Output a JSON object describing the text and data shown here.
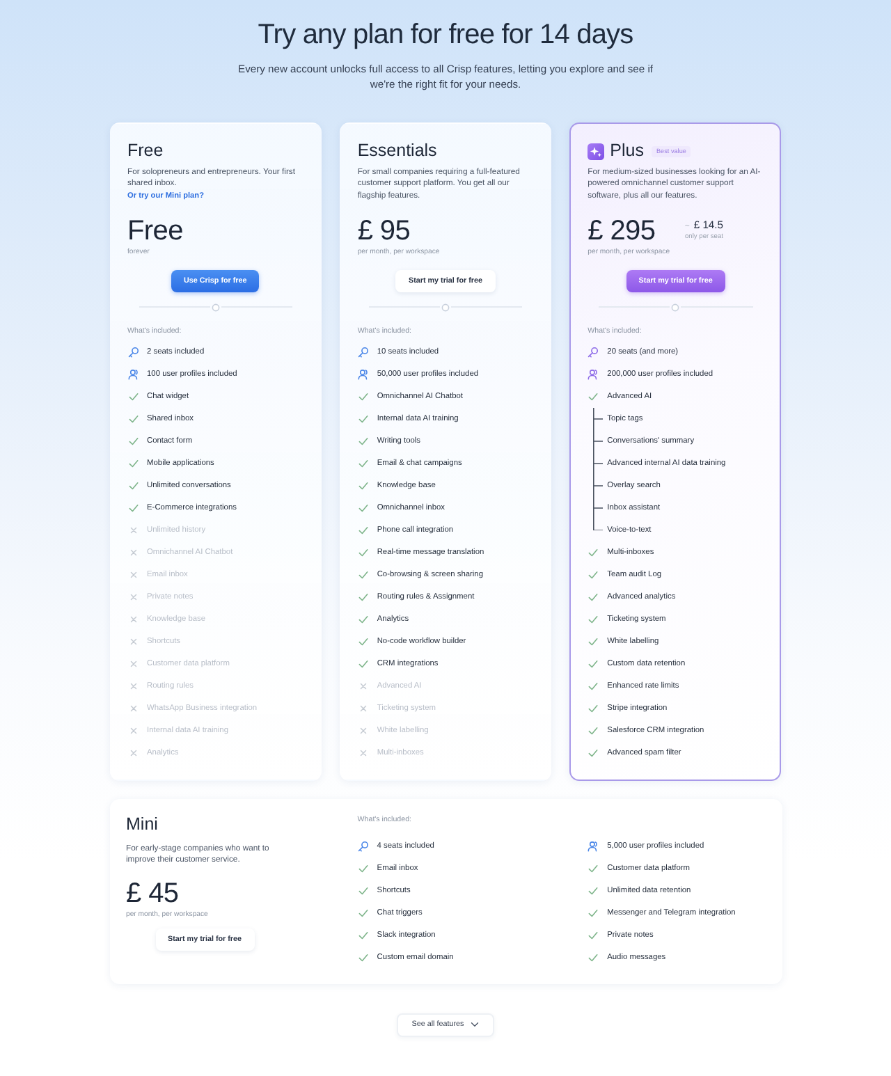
{
  "header": {
    "title": "Try any plan for free for 14 days",
    "subtitle": "Every new account unlocks full access to all Crisp features, letting you explore and see if we're the right fit for your needs."
  },
  "plans": [
    {
      "name": "Free",
      "featured": false,
      "description": "For solopreneurs and entrepreneurs. Your first shared inbox.",
      "link": "Or try our Mini plan?",
      "price": "Free",
      "price_note": "forever",
      "button": {
        "label": "Use Crisp for free",
        "kind": "primary"
      },
      "included_label": "What's included:",
      "features": [
        {
          "label": "2 seats included",
          "kind": "seats",
          "included": true
        },
        {
          "label": "100 user profiles included",
          "kind": "profiles",
          "included": true
        },
        {
          "label": "Chat widget",
          "kind": "feature",
          "included": true
        },
        {
          "label": "Shared inbox",
          "kind": "feature",
          "included": true
        },
        {
          "label": "Contact form",
          "kind": "feature",
          "included": true
        },
        {
          "label": "Mobile applications",
          "kind": "feature",
          "included": true
        },
        {
          "label": "Unlimited conversations",
          "kind": "feature",
          "included": true
        },
        {
          "label": "E-Commerce integrations",
          "kind": "feature",
          "included": true
        },
        {
          "label": "Unlimited history",
          "kind": "feature",
          "included": false
        },
        {
          "label": "Omnichannel AI Chatbot",
          "kind": "feature",
          "included": false
        },
        {
          "label": "Email inbox",
          "kind": "feature",
          "included": false
        },
        {
          "label": "Private notes",
          "kind": "feature",
          "included": false
        },
        {
          "label": "Knowledge base",
          "kind": "feature",
          "included": false
        },
        {
          "label": "Shortcuts",
          "kind": "feature",
          "included": false
        },
        {
          "label": "Customer data platform",
          "kind": "feature",
          "included": false
        },
        {
          "label": "Routing rules",
          "kind": "feature",
          "included": false
        },
        {
          "label": "WhatsApp Business integration",
          "kind": "feature",
          "included": false
        },
        {
          "label": "Internal data AI training",
          "kind": "feature",
          "included": false
        },
        {
          "label": "Analytics",
          "kind": "feature",
          "included": false
        }
      ]
    },
    {
      "name": "Essentials",
      "featured": false,
      "description": "For small companies requiring a full-featured customer support platform. You get all our flagship features.",
      "price": "£ 95",
      "price_note": "per month, per workspace",
      "button": {
        "label": "Start my trial for free",
        "kind": "secondary"
      },
      "included_label": "What's included:",
      "features": [
        {
          "label": "10 seats included",
          "kind": "seats",
          "included": true
        },
        {
          "label": "50,000 user profiles included",
          "kind": "profiles",
          "included": true
        },
        {
          "label": "Omnichannel AI Chatbot",
          "kind": "feature",
          "included": true
        },
        {
          "label": "Internal data AI training",
          "kind": "feature",
          "included": true
        },
        {
          "label": "Writing tools",
          "kind": "feature",
          "included": true
        },
        {
          "label": "Email & chat campaigns",
          "kind": "feature",
          "included": true
        },
        {
          "label": "Knowledge base",
          "kind": "feature",
          "included": true
        },
        {
          "label": "Omnichannel inbox",
          "kind": "feature",
          "included": true
        },
        {
          "label": "Phone call integration",
          "kind": "feature",
          "included": true
        },
        {
          "label": "Real-time message translation",
          "kind": "feature",
          "included": true
        },
        {
          "label": "Co-browsing & screen sharing",
          "kind": "feature",
          "included": true
        },
        {
          "label": "Routing rules & Assignment",
          "kind": "feature",
          "included": true
        },
        {
          "label": "Analytics",
          "kind": "feature",
          "included": true
        },
        {
          "label": "No-code workflow builder",
          "kind": "feature",
          "included": true
        },
        {
          "label": "CRM integrations",
          "kind": "feature",
          "included": true
        },
        {
          "label": "Advanced AI",
          "kind": "feature",
          "included": false
        },
        {
          "label": "Ticketing system",
          "kind": "feature",
          "included": false
        },
        {
          "label": "White labelling",
          "kind": "feature",
          "included": false
        },
        {
          "label": "Multi-inboxes",
          "kind": "feature",
          "included": false
        }
      ]
    },
    {
      "name": "Plus",
      "featured": true,
      "badge": "Best value",
      "description": "For medium-sized businesses looking for an AI-powered omnichannel customer support software, plus all our features.",
      "price": "£ 295",
      "seat_prefix": "~",
      "seat_price": "£ 14.5",
      "seat_note": "only per seat",
      "price_note": "per month, per workspace",
      "button": {
        "label": "Start my trial for free",
        "kind": "accent"
      },
      "included_label": "What's included:",
      "features": [
        {
          "label": "20 seats (and more)",
          "kind": "seats",
          "included": true
        },
        {
          "label": "200,000 user profiles included",
          "kind": "profiles",
          "included": true
        },
        {
          "label": "Advanced AI",
          "kind": "feature",
          "included": true,
          "children": [
            {
              "label": "Topic tags"
            },
            {
              "label": "Conversations' summary"
            },
            {
              "label": "Advanced internal AI data training"
            },
            {
              "label": "Overlay search"
            },
            {
              "label": "Inbox assistant"
            },
            {
              "label": "Voice-to-text"
            }
          ]
        },
        {
          "label": "Multi-inboxes",
          "kind": "feature",
          "included": true
        },
        {
          "label": "Team audit Log",
          "kind": "feature",
          "included": true
        },
        {
          "label": "Advanced analytics",
          "kind": "feature",
          "included": true
        },
        {
          "label": "Ticketing system",
          "kind": "feature",
          "included": true
        },
        {
          "label": "White labelling",
          "kind": "feature",
          "included": true
        },
        {
          "label": "Custom data retention",
          "kind": "feature",
          "included": true
        },
        {
          "label": "Enhanced rate limits",
          "kind": "feature",
          "included": true
        },
        {
          "label": "Stripe integration",
          "kind": "feature",
          "included": true
        },
        {
          "label": "Salesforce CRM integration",
          "kind": "feature",
          "included": true
        },
        {
          "label": "Advanced spam filter",
          "kind": "feature",
          "included": true
        }
      ]
    }
  ],
  "mini": {
    "name": "Mini",
    "description": "For early-stage companies who want to improve their customer service.",
    "price": "£ 45",
    "price_note": "per month, per workspace",
    "button": {
      "label": "Start my trial for free",
      "kind": "secondary"
    },
    "included_label": "What's included:",
    "features": [
      {
        "label": "4 seats included",
        "kind": "seats",
        "included": true
      },
      {
        "label": "Email inbox",
        "kind": "feature",
        "included": true
      },
      {
        "label": "Shortcuts",
        "kind": "feature",
        "included": true
      },
      {
        "label": "Chat triggers",
        "kind": "feature",
        "included": true
      },
      {
        "label": "Slack integration",
        "kind": "feature",
        "included": true
      },
      {
        "label": "Custom email domain",
        "kind": "feature",
        "included": true
      },
      {
        "label": "5,000 user profiles included",
        "kind": "profiles",
        "included": true
      },
      {
        "label": "Customer data platform",
        "kind": "feature",
        "included": true
      },
      {
        "label": "Unlimited data retention",
        "kind": "feature",
        "included": true
      },
      {
        "label": "Messenger and Telegram integration",
        "kind": "feature",
        "included": true
      },
      {
        "label": "Private notes",
        "kind": "feature",
        "included": true
      },
      {
        "label": "Audio messages",
        "kind": "feature",
        "included": true
      }
    ]
  },
  "footer_button": {
    "label": "See all features"
  }
}
